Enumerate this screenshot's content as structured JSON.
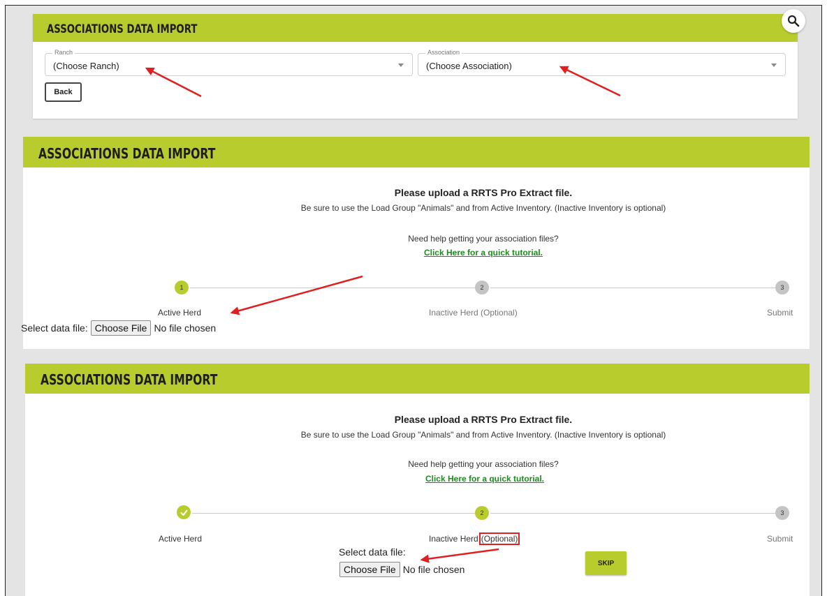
{
  "colors": {
    "accent": "#b8cc2e",
    "annotation_red": "#e02020",
    "link_green": "#1f8a1f"
  },
  "panel1": {
    "banner": "ASSOCIATIONS DATA IMPORT",
    "ranch": {
      "label": "Ranch",
      "value": "(Choose Ranch)"
    },
    "association": {
      "label": "Association",
      "value": "(Choose Association)"
    },
    "back": "Back",
    "search_icon": "search-icon"
  },
  "panel2": {
    "banner": "ASSOCIATIONS DATA IMPORT",
    "title": "Please upload a RRTS Pro Extract file.",
    "subtitle": "Be sure to use the Load Group \"Animals\" and from Active Inventory. (Inactive Inventory is optional)",
    "help": "Need help getting your association files?",
    "link": "Click Here for a quick tutorial.",
    "steps": [
      {
        "num": "1",
        "label": "Active Herd",
        "state": "active"
      },
      {
        "num": "2",
        "label": "Inactive Herd (Optional)",
        "state": "inactive"
      },
      {
        "num": "3",
        "label": "Submit",
        "state": "inactive"
      }
    ],
    "file": {
      "label": "Select data file:",
      "button": "Choose File",
      "status": "No file chosen"
    }
  },
  "panel3": {
    "banner": "ASSOCIATIONS DATA IMPORT",
    "title": "Please upload a RRTS Pro Extract file.",
    "subtitle": "Be sure to use the Load Group \"Animals\" and from Active Inventory. (Inactive Inventory is optional)",
    "help": "Need help getting your association files?",
    "link": "Click Here for a quick tutorial.",
    "steps": [
      {
        "num": "✓",
        "label": "Active Herd",
        "state": "done"
      },
      {
        "num": "2",
        "label": "Inactive Herd",
        "label_highlight": "(Optional)",
        "state": "active"
      },
      {
        "num": "3",
        "label": "Submit",
        "state": "inactive"
      }
    ],
    "file": {
      "label": "Select data file:",
      "button": "Choose File",
      "status": "No file chosen"
    },
    "skip": "SKIP"
  }
}
